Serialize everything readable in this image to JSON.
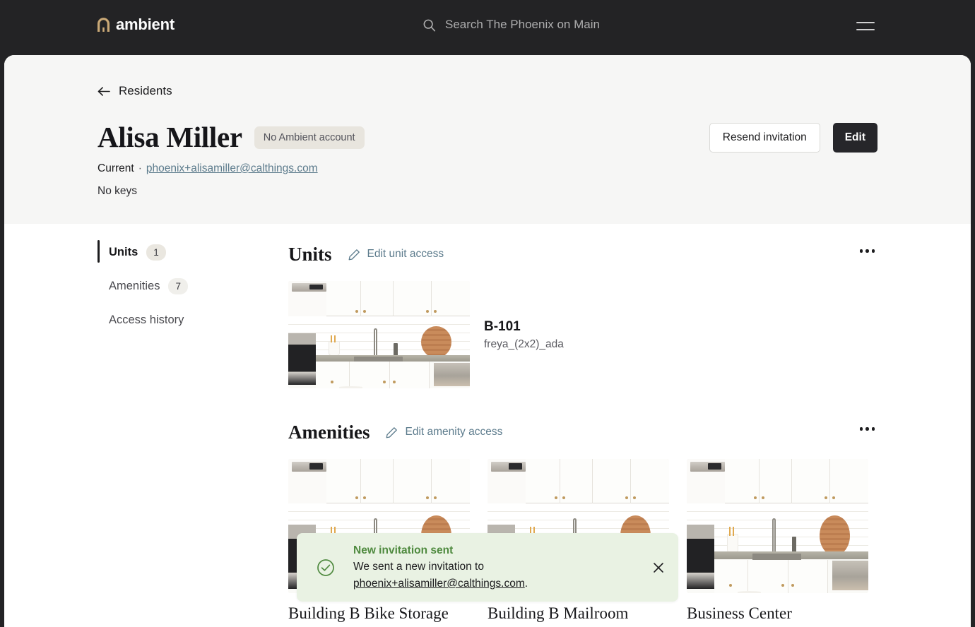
{
  "topbar": {
    "brand": "ambient",
    "brand_icon": "arch-logo-icon",
    "brand_color": "#c9a876",
    "search_icon": "search-icon",
    "search_placeholder": "Search The Phoenix on Main",
    "menu_icon": "hamburger-menu-icon"
  },
  "header": {
    "back_icon": "arrow-left-icon",
    "back_label": "Residents",
    "name": "Alisa Miller",
    "account_badge": "No Ambient account",
    "status_label": "Current",
    "separator": "·",
    "email": "phoenix+alisamiller@calthings.com",
    "keys_label": "No keys",
    "resend_label": "Resend invitation",
    "edit_label": "Edit"
  },
  "sidebar": {
    "items": [
      {
        "label": "Units",
        "count": "1",
        "active": true
      },
      {
        "label": "Amenities",
        "count": "7",
        "active": false
      },
      {
        "label": "Access history",
        "count": "",
        "active": false
      }
    ]
  },
  "units_section": {
    "title": "Units",
    "action_icon": "pencil-icon",
    "action_label": "Edit unit access",
    "overflow_icon": "more-horizontal-icon",
    "units": [
      {
        "name": "B-101",
        "floorplan": "freya_(2x2)_ada",
        "image": "kitchen-photo"
      }
    ]
  },
  "amenities_section": {
    "title": "Amenities",
    "action_icon": "pencil-icon",
    "action_label": "Edit amenity access",
    "overflow_icon": "more-horizontal-icon",
    "amenities": [
      {
        "name": "Building B Bike Storage",
        "image": "kitchen-photo"
      },
      {
        "name": "Building B Mailroom",
        "image": "kitchen-photo"
      },
      {
        "name": "Business Center",
        "image": "kitchen-photo"
      }
    ]
  },
  "toast": {
    "icon": "check-circle-icon",
    "title": "New invitation sent",
    "message_prefix": "We sent a new invitation to",
    "email": "phoenix+alisamiller@calthings.com",
    "message_suffix": ".",
    "close_icon": "close-icon",
    "accent_color": "#4f8a3f",
    "background_color": "#e9f2e3"
  }
}
